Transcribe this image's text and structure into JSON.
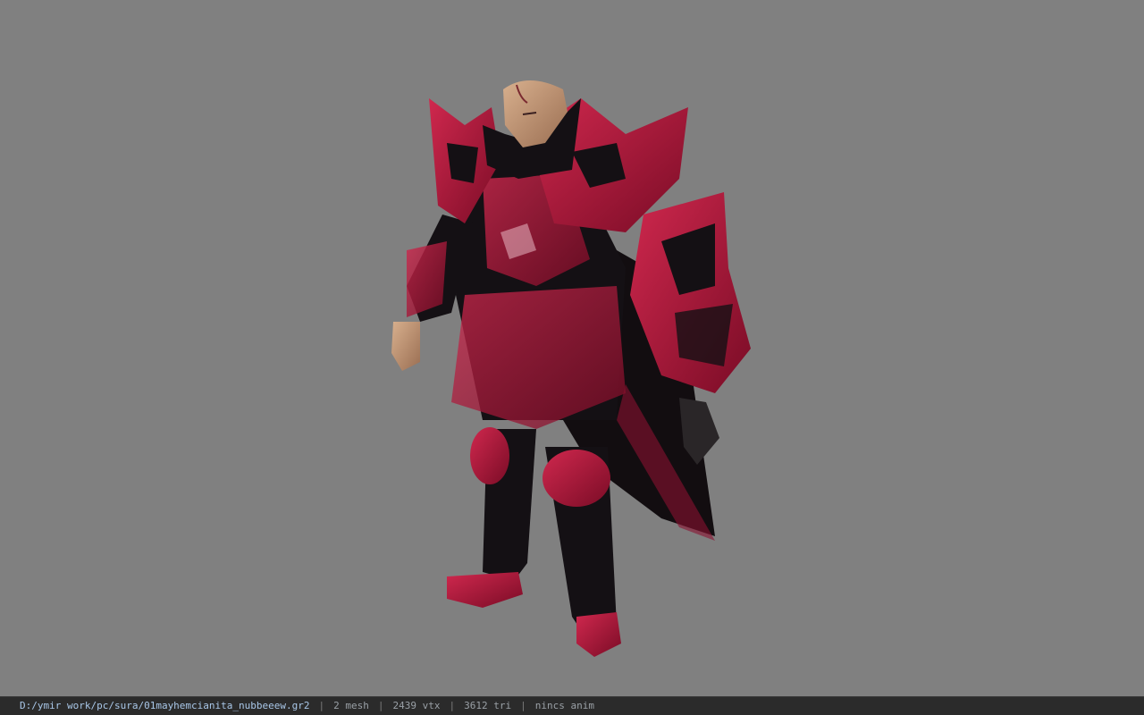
{
  "viewer": {
    "background_color": "#808080",
    "model_subject": "armored-character"
  },
  "statusbar": {
    "file_path": "D:/ymir work/pc/sura/01mayhemcianita_nubbeeew.gr2",
    "separator": "|",
    "mesh_count": "2 mesh",
    "vertex_count": "2439 vtx",
    "triangle_count": "3612 tri",
    "animation": "nincs anim"
  },
  "colors": {
    "armor_red": "#b0143c",
    "armor_black": "#141014",
    "skin": "#c89a7a"
  }
}
